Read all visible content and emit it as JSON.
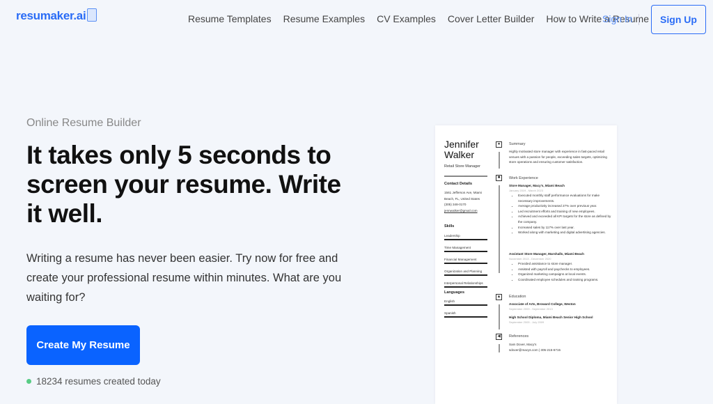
{
  "nav": {
    "logo": "resumaker.ai",
    "links": [
      "Resume Templates",
      "Resume Examples",
      "CV Examples",
      "Cover Letter Builder",
      "How to Write a Resume"
    ],
    "sign_in": "Sign In",
    "sign_up": "Sign Up"
  },
  "hero": {
    "eyebrow": "Online Resume Builder",
    "title": "It takes only 5 seconds to screen your resume. Write it well.",
    "subtitle": "Writing a resume has never been easier. Try now for free and create your professional resume within minutes. What are you waiting for?",
    "cta": "Create My Resume",
    "count": "18234 resumes created today",
    "accent": "#0a63ff",
    "status_color": "#58cc84"
  },
  "resume": {
    "first": "Jennifer",
    "last": "Walker",
    "role": "Retail Store Manager",
    "contact_title": "Contact Details",
    "address1": "1561 Jefferson Ave, Miami",
    "address2": "Beach, FL, United States",
    "phone": "(305) 348-0170",
    "email": "jennwalker@gmail.com",
    "skills_title": "Skills",
    "skills": [
      "Leadership",
      "Time Management",
      "Financial Management",
      "Organization and Planning",
      "Interpersonal Relationships"
    ],
    "languages_title": "Languages",
    "languages": [
      "English",
      "Spanish"
    ],
    "summary_title": "Summary",
    "summary": "Highly motivated store manager with experience in fast-paced retail venues with a passion for people, exceeding sales targets, optimizing store operations and ensuring customer satisfaction.",
    "work_title": "Work Experience",
    "job1": {
      "title": "Store Manager, Macy's, Miami Beach",
      "date": "January 2019 - March 2023",
      "bullets": [
        "Executed monthly staff performance evaluations for make necessary improvements.",
        "Average productivity increased 27% over previous year.",
        "Led recruitment efforts and training of new employees.",
        "Achieved and exceeded all KPI targets for the store as defined by the company.",
        "Increased sales by 117% over last year.",
        "Worked along with marketing and digital advertising agencies."
      ]
    },
    "job2": {
      "title": "Assistant Store Manager, Marshalls, Miami Beach",
      "date": "November 2013 - December 2020",
      "bullets": [
        "Provided assistance to store manager.",
        "Assisted with payroll and paychecks to employees.",
        "Organized marketing campaigns at local events.",
        "Coordinated employee schedules and training programs."
      ]
    },
    "education_title": "Education",
    "edu1": {
      "title": "Associate of Arts, Broward College, Weston",
      "date": "September 2009 - September 2013"
    },
    "edu2": {
      "title": "High School Diploma, Miami Beach Senior High School",
      "date": "September 2005 - July 2009"
    },
    "references_title": "References",
    "ref_name": "Sam Dover, Macy's",
    "ref_contact": "sdover@macys.com | 305-215-6715"
  }
}
